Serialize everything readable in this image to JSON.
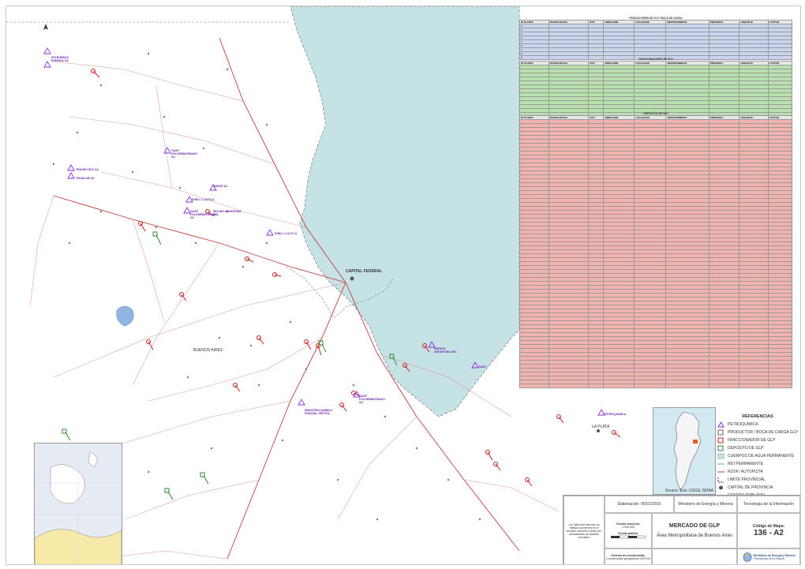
{
  "colors": {
    "river": "#c5e2e4",
    "route": "#c43c3c",
    "blue_rows": "#c9d5ef",
    "green_rows": "#b8e0ad",
    "red_rows": "#f2b3ae",
    "producer_mark": "#8a2be2",
    "deposit_mark": "#2e8b2e"
  },
  "table": {
    "title1": "PRODUCTORES DE GLP / BOCA DE CARGA",
    "title2": "FRACCIONADORES DE GLP",
    "title3": "DEPOSITOS DE GLP",
    "headers": [
      "ID PLANTA",
      "RAZON SOCIAL",
      "CUIT",
      "DIRECCION",
      "LOCALIDAD",
      "DEPARTAMENTO",
      "PROVINCIA",
      "LONGITUD",
      "LATITUD"
    ],
    "blue_rows": [
      [
        "1",
        "",
        "",
        "",
        "",
        "",
        "",
        "",
        ""
      ],
      [
        "2",
        "",
        "",
        "",
        "",
        "",
        "",
        "",
        ""
      ],
      [
        "3",
        "",
        "",
        "",
        "",
        "",
        "",
        "",
        ""
      ],
      [
        "4",
        "",
        "",
        "",
        "",
        "",
        "",
        "",
        ""
      ],
      [
        "5",
        "",
        "",
        "",
        "",
        "",
        "",
        "",
        ""
      ],
      [
        "6",
        "",
        "",
        "",
        "",
        "",
        "",
        "",
        ""
      ],
      [
        "7",
        "",
        "",
        "",
        "",
        "",
        "",
        "",
        ""
      ],
      [
        "8",
        "",
        "",
        "",
        "",
        "",
        "",
        "",
        ""
      ],
      [
        "9",
        "",
        "",
        "",
        "",
        "",
        "",
        "",
        ""
      ]
    ],
    "green_rows_count": 13,
    "red_rows_count": 68
  },
  "map_labels": {
    "capital": "CAPITAL FEDERAL",
    "la_plata": "LA PLATA",
    "buenos_aires": "BUENOS AIRES",
    "buenos_aires_alt": "BUENOS AIRES"
  },
  "facility_labels": [
    "PETROBRAS ENERGIA SA",
    "TRANSLOGIC SA",
    "GASP FOLGERBATRIANO SA",
    "TRIVALUR SA",
    "ANDES SA",
    "SHELL C.A.P.S.A.",
    "GASP FOLGERBATRIANO SA",
    "SHELL C.A.P.S.A.",
    "INDUSTRIA QUIMICA ESSIONS, SROTPA",
    "GASP FOLGERBATRIANO SA",
    "GASP",
    "MOLINO ARGENTINA SRL",
    "SMRHTA ARGENTINA SRL",
    "PETROQUIMICA"
  ],
  "legend": {
    "title": "REFERENCIAS",
    "items": [
      {
        "label": "PETROQUIMICA",
        "icon": "triangle-icon"
      },
      {
        "label": "PRODUCTOR / BOCA DE CARGA  GLP",
        "icon": "square-icon"
      },
      {
        "label": "FRACCIONADOR DE GLP",
        "icon": "square-icon"
      },
      {
        "label": "DEPOSITO DE GLP",
        "icon": "square-icon"
      },
      {
        "label": "CUERPOS DE AGUA PERMANENTE",
        "icon": "water-icon"
      },
      {
        "label": "RIO PERMANENTE",
        "icon": "line-icon"
      },
      {
        "label": "RUTA / AUTOPISTA",
        "icon": "road-icon"
      },
      {
        "label": "LIMITE PROVINCIAL",
        "icon": "limit-icon"
      },
      {
        "label": "CAPITAL DE PROVINCIA",
        "icon": "dot-icon"
      },
      {
        "label": "CENTRO POBLADO",
        "icon": "dot-icon"
      }
    ]
  },
  "inset": {
    "source": "Source: Esri, USGS, NOAA"
  },
  "title_block": {
    "disclaimer": "Los datos del mercado no reflejan volumenes en el territorio nacional y deben ser considerados de caracter orientativo",
    "elaboracion": "Elaboración: 05/01/2016",
    "ministerio": "Ministerio de Energía y Minería",
    "tecnologia": "Tecnología de la Información",
    "escala_num_label": "Escala numérica:",
    "escala_num": "1:300.000",
    "escala_graf_label": "Escala gráfica:",
    "mercado": "MERCADO DE GLP",
    "codigo_label": "Código de Mapa:",
    "codigo": "136 - A2",
    "area": "Área Metropolitana de Buenos Aires",
    "sistema_label": "Sistema de coordenadas:",
    "sistema": "Coordenadas geográficas WGS 84",
    "logo_line1": "Ministerio de Energía y Minería",
    "logo_line2": "Presidencia de la Nación"
  }
}
